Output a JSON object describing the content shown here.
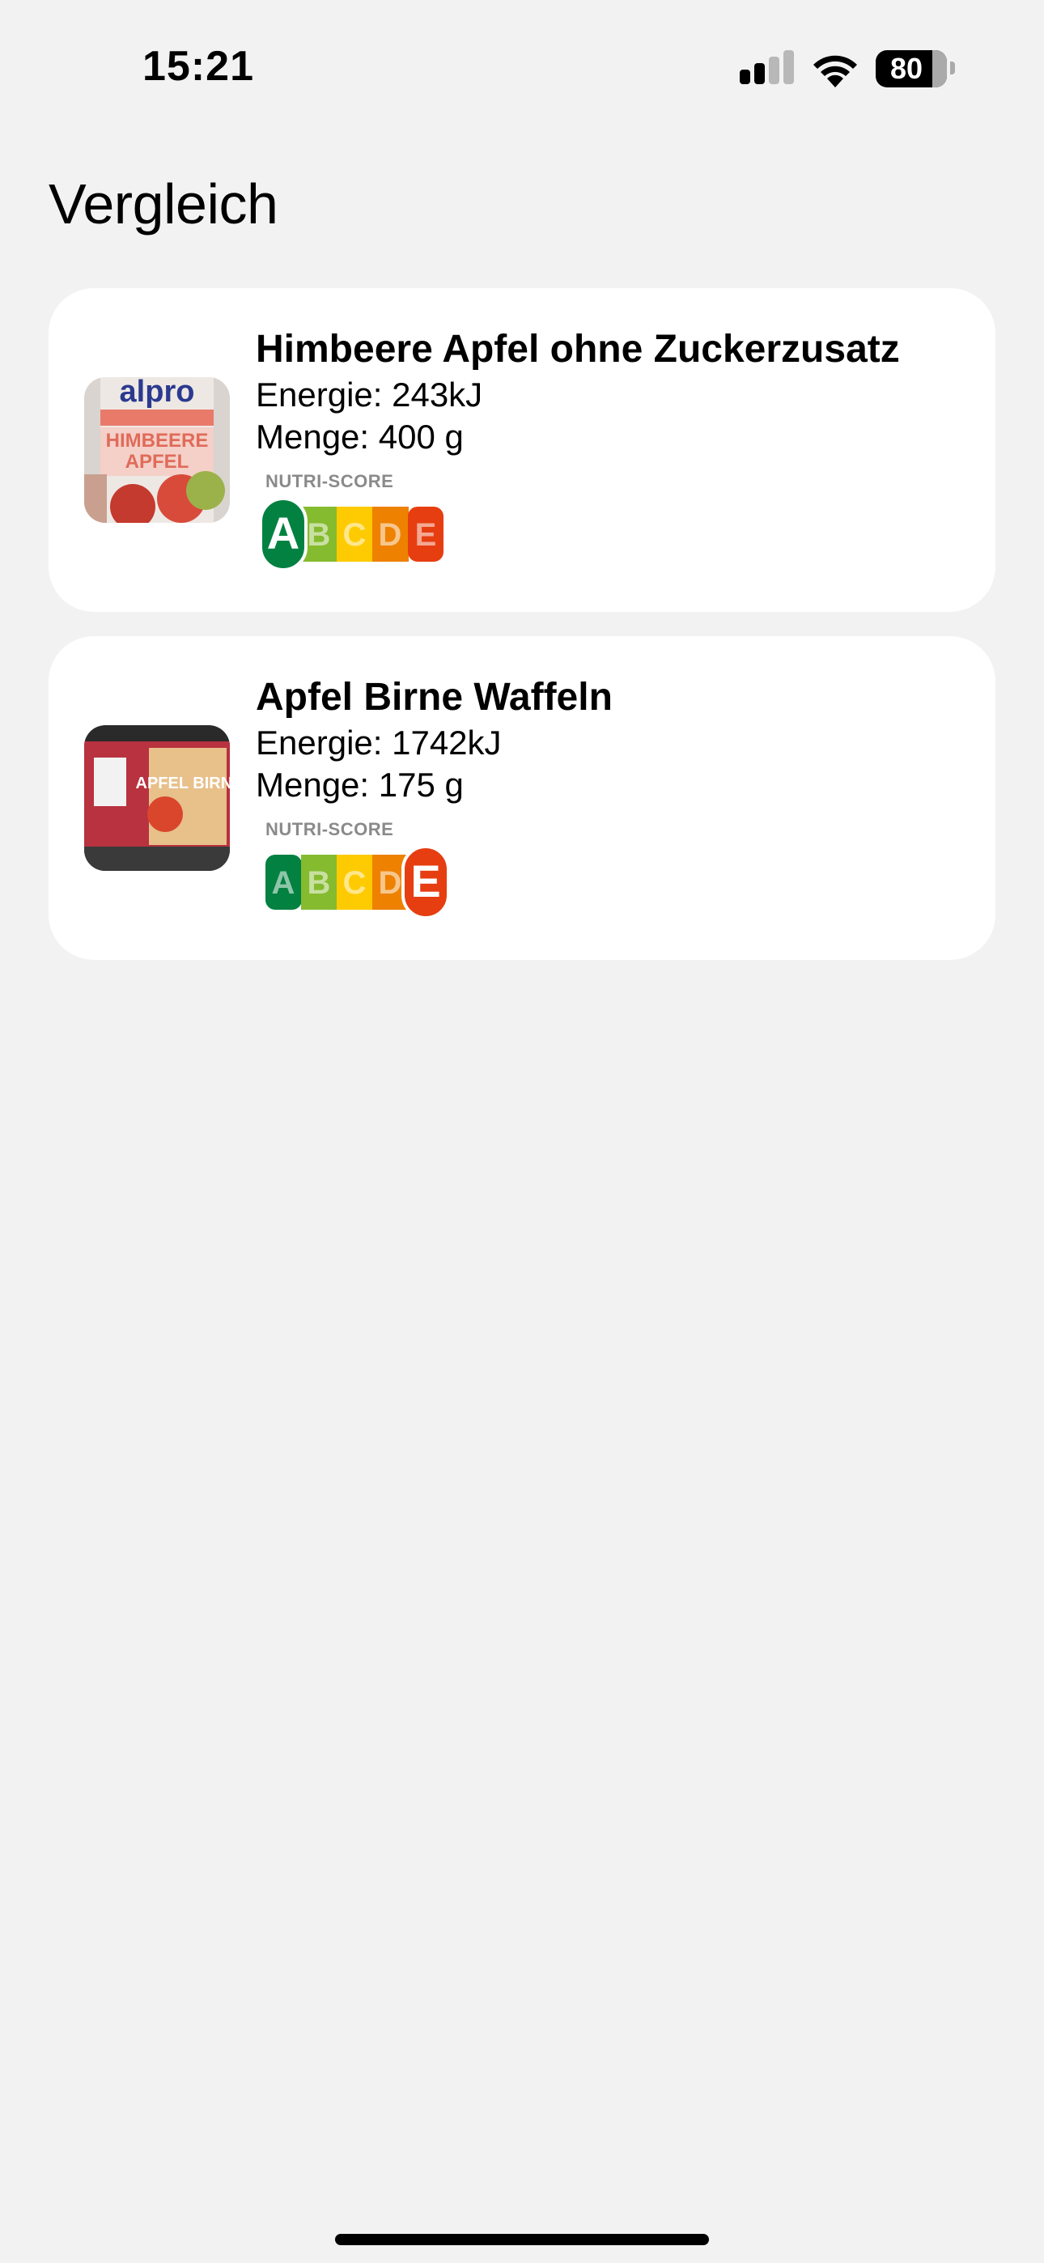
{
  "status_bar": {
    "time": "15:21",
    "battery_percent": "80",
    "signal_bars_active": 2,
    "signal_bars_total": 4
  },
  "page": {
    "title": "Vergleich"
  },
  "nutri_score": {
    "label": "NUTRI-SCORE",
    "grades": [
      "A",
      "B",
      "C",
      "D",
      "E"
    ],
    "colors": [
      "#038141",
      "#85BB2F",
      "#FECB02",
      "#EE8100",
      "#E63E11"
    ]
  },
  "products": [
    {
      "name": "Himbeere Apfel ohne Zuckerzusatz",
      "energy": "Energie: 243kJ",
      "quantity": "Menge: 400 g",
      "grade": "A",
      "image": "alpro-raspberry-apple-yogurt-photo",
      "image_text": "alpro"
    },
    {
      "name": "Apfel Birne Waffeln",
      "energy": "Energie: 1742kJ",
      "quantity": "Menge: 175 g",
      "grade": "E",
      "image": "apple-pear-waffles-package-photo",
      "image_text": "APFEL BIRNE"
    }
  ]
}
